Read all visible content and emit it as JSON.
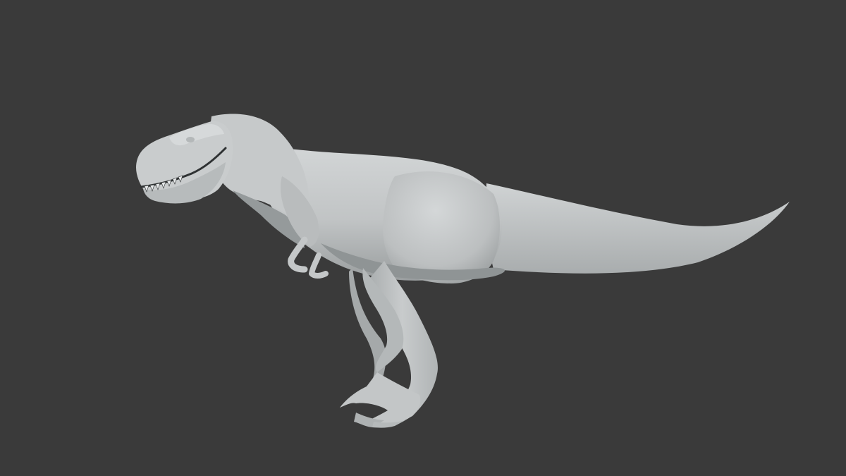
{
  "viewport": {
    "background_color": "#3a3a3a",
    "model": {
      "subject": "t-rex-model",
      "render_style": "clay",
      "base_color": "#c2c5c6",
      "shadow_color": "#8c9192",
      "highlight_color": "#d6d9da"
    }
  }
}
